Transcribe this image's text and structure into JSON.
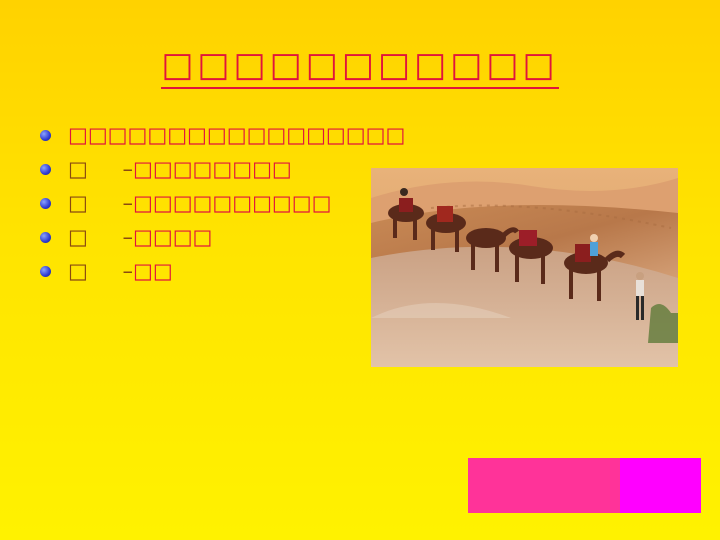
{
  "slide": {
    "title": "□□□□□□□□□□□",
    "bullets": [
      {
        "text": "□□□□□□□□□□□□□□□□□"
      },
      {
        "lead": "□",
        "sep": "–",
        "rest": "□□□□□□□□"
      },
      {
        "lead": "□",
        "sep": "–",
        "rest": "□□□□□□□□□□"
      },
      {
        "lead": "□",
        "sep": "–",
        "rest": "□□□□"
      },
      {
        "lead": "□",
        "sep": "–",
        "rest": "□□"
      }
    ]
  },
  "image": {
    "subject": "camel-caravan-desert-photo"
  },
  "colors": {
    "background": "#ffd800",
    "title": "#e0143c",
    "bullet_dot": "#2e3ad0",
    "nav_primary": "#ff3399",
    "nav_secondary": "#ff00ff"
  }
}
